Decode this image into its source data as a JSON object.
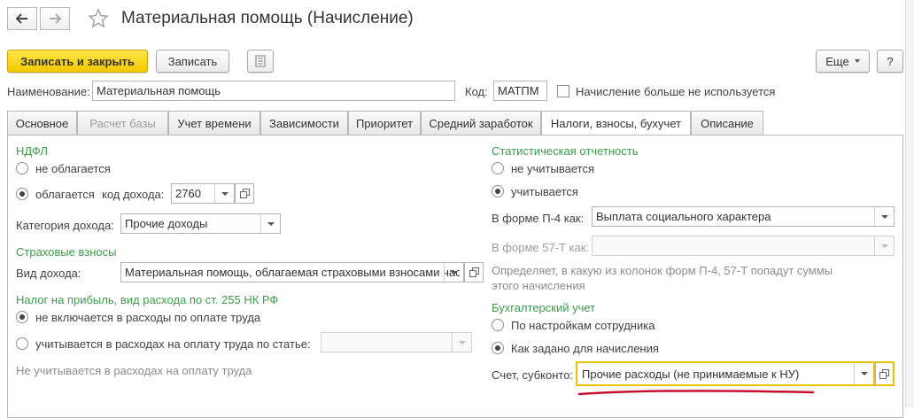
{
  "window": {
    "title": "Материальная помощь (Начисление)"
  },
  "toolbar": {
    "save_close_label": "Записать и закрыть",
    "save_label": "Записать",
    "more_label": "Еще",
    "help_label": "?"
  },
  "header": {
    "name_label": "Наименование:",
    "name_value": "Материальная помощь",
    "code_label": "Код:",
    "code_value": "МАТПМ",
    "unused_label": "Начисление больше не используется"
  },
  "tabs": [
    {
      "label": "Основное"
    },
    {
      "label": "Расчет базы"
    },
    {
      "label": "Учет времени"
    },
    {
      "label": "Зависимости"
    },
    {
      "label": "Приоритет"
    },
    {
      "label": "Средний заработок"
    },
    {
      "label": "Налоги, взносы, бухучет"
    },
    {
      "label": "Описание"
    }
  ],
  "left": {
    "ndfl_title": "НДФЛ",
    "not_taxed_label": "не облагается",
    "taxed_label": "облагается",
    "income_code_label": "код дохода:",
    "income_code_value": "2760",
    "income_category_label": "Категория дохода:",
    "income_category_value": "Прочие доходы",
    "insurance_title": "Страховые взносы",
    "income_type_label": "Вид дохода:",
    "income_type_value": "Материальная помощь, облагаемая страховыми взносами частично",
    "profit_tax_title": "Налог на прибыль, вид расхода по ст. 255 НК РФ",
    "not_included_label": "не включается в расходы по оплате труда",
    "included_label": "учитывается в расходах на оплату труда по статье:",
    "included_value": "",
    "profit_note": "Не учитывается в расходах на оплату труда"
  },
  "right": {
    "stat_title": "Статистическая отчетность",
    "stat_not_counted_label": "не учитывается",
    "stat_counted_label": "учитывается",
    "p4_label": "В форме П-4 как:",
    "p4_value": "Выплата социального характера",
    "f57_label": "В форме 57-Т как:",
    "f57_value": "",
    "stat_note_1": "Определяет, в какую из колонок форм П-4, 57-Т попадут суммы",
    "stat_note_2": "этого начисления",
    "acc_title": "Бухгалтерский учет",
    "acc_by_settings_label": "По настройкам сотрудника",
    "acc_as_set_label": "Как задано для начисления",
    "account_label": "Счет, субконто:",
    "account_value": "Прочие расходы (не принимаемые к НУ)"
  },
  "colors": {
    "primary_button": "#f5c800",
    "section_title": "#3f9a4c",
    "focus_border": "#e6c400",
    "underline": "#c8102e"
  }
}
